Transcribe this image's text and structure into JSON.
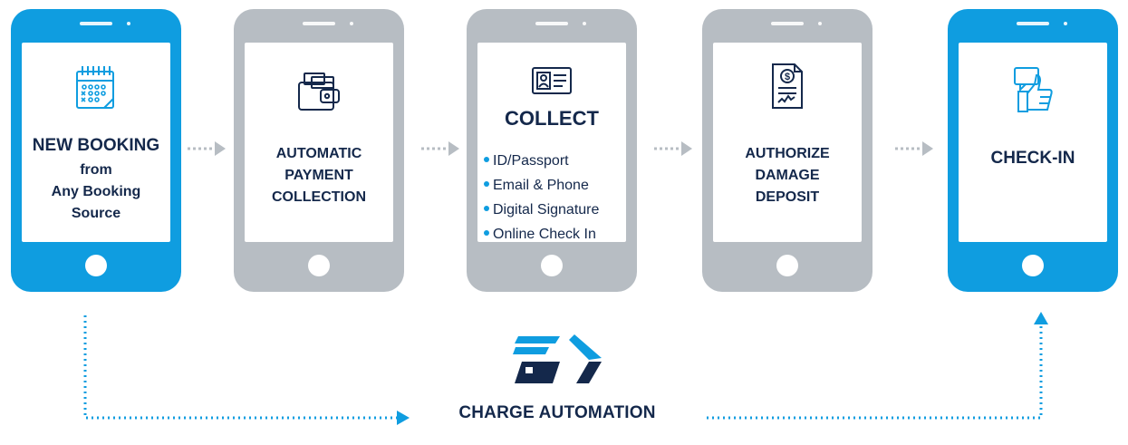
{
  "steps": [
    {
      "id": "new-booking",
      "color": "blue",
      "icon": "calendar-icon",
      "title": "NEW BOOKING",
      "subtitle_lines": [
        "from",
        "Any Booking",
        "Source"
      ]
    },
    {
      "id": "payment",
      "color": "gray",
      "icon": "wallet-icon",
      "title_lines": [
        "AUTOMATIC",
        "PAYMENT",
        "COLLECTION"
      ]
    },
    {
      "id": "collect",
      "color": "gray",
      "icon": "id-card-icon",
      "title": "COLLECT",
      "items": [
        "ID/Passport",
        "Email & Phone",
        "Digital Signature",
        "Online Check In"
      ]
    },
    {
      "id": "deposit",
      "color": "gray",
      "icon": "invoice-icon",
      "title_lines": [
        "AUTHORIZE",
        "DAMAGE",
        "DEPOSIT"
      ]
    },
    {
      "id": "check-in",
      "color": "blue",
      "icon": "thumbs-up-icon",
      "title": "CHECK-IN"
    }
  ],
  "brand": {
    "name": "CHARGE AUTOMATION",
    "icon": "charge-automation-logo-icon"
  },
  "colors": {
    "blue": "#0f9de0",
    "gray": "#b7bdc3",
    "navy": "#14284b",
    "arrow": "#b7bdc3",
    "dotted_path": "#0f9de0"
  }
}
